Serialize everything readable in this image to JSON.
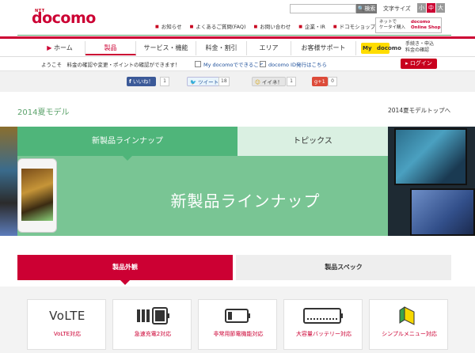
{
  "header": {
    "logo_small": "NTT",
    "logo": "docomo",
    "search_button": "検索",
    "font_size_label": "文字サイズ",
    "font_sizes": [
      "小",
      "中",
      "大"
    ],
    "util_links": [
      "お知らせ",
      "よくあるご質問(FAQ)",
      "お問い合わせ",
      "企業・IR",
      "ドコモショップ"
    ],
    "onlineshop_left": "ネットで\nケータイ購入",
    "onlineshop_right": "docomo\nOnline Shop"
  },
  "nav": {
    "items": [
      "ホーム",
      "製品",
      "サービス・機能",
      "料金・割引",
      "エリア",
      "お客様サポート"
    ],
    "my_badge": "My",
    "my_text": "docomo",
    "my_sub": "手続き・申込\n料金の確認"
  },
  "welcome": {
    "text": "ようこそ　料金の確認や変更・ポイントの確認ができます！",
    "link1": "My docomoでできること",
    "link2": "docomo ID発行はこちら",
    "login": "ログイン"
  },
  "social": {
    "facebook": "いいね！",
    "facebook_count": "1",
    "twitter": "ツイート",
    "twitter_count": "18",
    "mixi": "イイネ！",
    "mixi_count": "1",
    "gplus": "g+1",
    "gplus_count": "0"
  },
  "model": {
    "title": "2014夏モデル",
    "top_link": "2014夏モデルトップへ"
  },
  "banner": {
    "tab_lineup": "新製品ラインナップ",
    "tab_topics": "トピックス",
    "headline": "新製品ラインナップ"
  },
  "spec": {
    "tab_exterior": "製品外観",
    "tab_spec": "製品スペック"
  },
  "features": [
    {
      "icon": "volte-icon",
      "label": "VoLTE対応",
      "icon_text": "VoLTE"
    },
    {
      "icon": "fast-charge-icon",
      "label": "急速充電2対応"
    },
    {
      "icon": "battery-saver-icon",
      "label": "非常用節電機能対応"
    },
    {
      "icon": "large-battery-icon",
      "label": "大容量バッテリー対応",
      "icon_text": "大容量バッテリー"
    },
    {
      "icon": "simple-menu-icon",
      "label": "シンプルメニュー対応"
    }
  ],
  "colors": {
    "brand": "#cc0033",
    "green": "#4fb57a",
    "green_light": "#79c594"
  }
}
